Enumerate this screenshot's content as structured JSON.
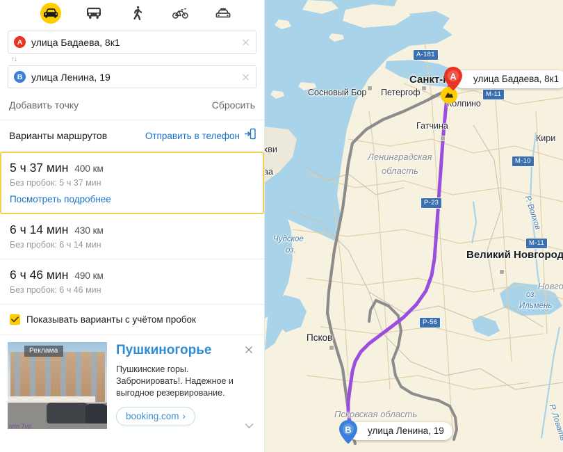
{
  "sidebar": {
    "modes": [
      {
        "name": "car",
        "icon": "car-icon",
        "active": true
      },
      {
        "name": "transit",
        "icon": "bus-icon",
        "active": false
      },
      {
        "name": "walk",
        "icon": "walk-icon",
        "active": false
      },
      {
        "name": "bike",
        "icon": "bicycle-icon",
        "active": false
      },
      {
        "name": "taxi",
        "icon": "taxi-icon",
        "active": false
      }
    ],
    "fields": {
      "from": {
        "badge": "A",
        "value": "улица Бадаева, 8к1",
        "color": "#eb3323"
      },
      "to": {
        "badge": "B",
        "value": "улица Ленина, 19",
        "color": "#3a7fdb"
      },
      "swap_icon": "↑↓"
    },
    "add_point_label": "Добавить точку",
    "reset_label": "Сбросить",
    "variants_title": "Варианты маршрутов",
    "send_to_phone_label": "Отправить в телефон",
    "routes": [
      {
        "time": "5 ч 37 мин",
        "distance": "400 км",
        "no_traffic": "Без пробок: 5 ч 37 мин",
        "details_label": "Посмотреть подробнее",
        "selected": true
      },
      {
        "time": "6 ч 14 мин",
        "distance": "430 км",
        "no_traffic": "Без пробок: 6 ч 14 мин",
        "details_label": "",
        "selected": false
      },
      {
        "time": "6 ч 46 мин",
        "distance": "490 км",
        "no_traffic": "Без пробок: 6 ч 46 мин",
        "details_label": "",
        "selected": false
      }
    ],
    "traffic_checkbox": {
      "label": "Показывать варианты с учётом пробок",
      "checked": true,
      "color": "#ffcc00"
    },
    "ad": {
      "badge": "Реклама",
      "title": "Пушкиногорье",
      "text": "Пушкинские горы. Забронировать!. Надежное и выгодное резервирование.",
      "button_label": "booking.com",
      "button_chevron": "›",
      "watermark": "ппп Тур."
    }
  },
  "map": {
    "route_color": "#9b4edd",
    "alt_route_color": "#8c8c8c",
    "water_color": "#a8d3e8",
    "land_color": "#f7f2e0",
    "markers": [
      {
        "letter": "A",
        "label": "улица Бадаева, 8к1",
        "color": "#eb3323"
      },
      {
        "letter": "B",
        "label": "улица Ленина, 19",
        "color": "#3a7fdb"
      }
    ],
    "cities": [
      {
        "name": "Санкт-Пе",
        "size": "lg"
      },
      {
        "name": "Великий Новгород",
        "size": "lg"
      },
      {
        "name": "Псков",
        "size": "md"
      },
      {
        "name": "Петергоф",
        "size": "sm"
      },
      {
        "name": "Сосновый Бор",
        "size": "sm"
      },
      {
        "name": "Гатчина",
        "size": "sm"
      },
      {
        "name": "Колпино",
        "size": "sm"
      },
      {
        "name": "Кири",
        "size": "sm"
      },
      {
        "name": "хви",
        "size": "sm"
      },
      {
        "name": "аа",
        "size": "sm"
      }
    ],
    "regions": [
      "Ленинградская",
      "область",
      "Псковская область",
      "Новго"
    ],
    "waters": [
      "Чудское",
      "оз.",
      "оз.",
      "Ильмень",
      "Р. Волхов",
      "Р. Ловать"
    ],
    "shields": [
      "A-181",
      "М-11",
      "М-10",
      "М-11",
      "Р-23",
      "Р-56"
    ]
  }
}
